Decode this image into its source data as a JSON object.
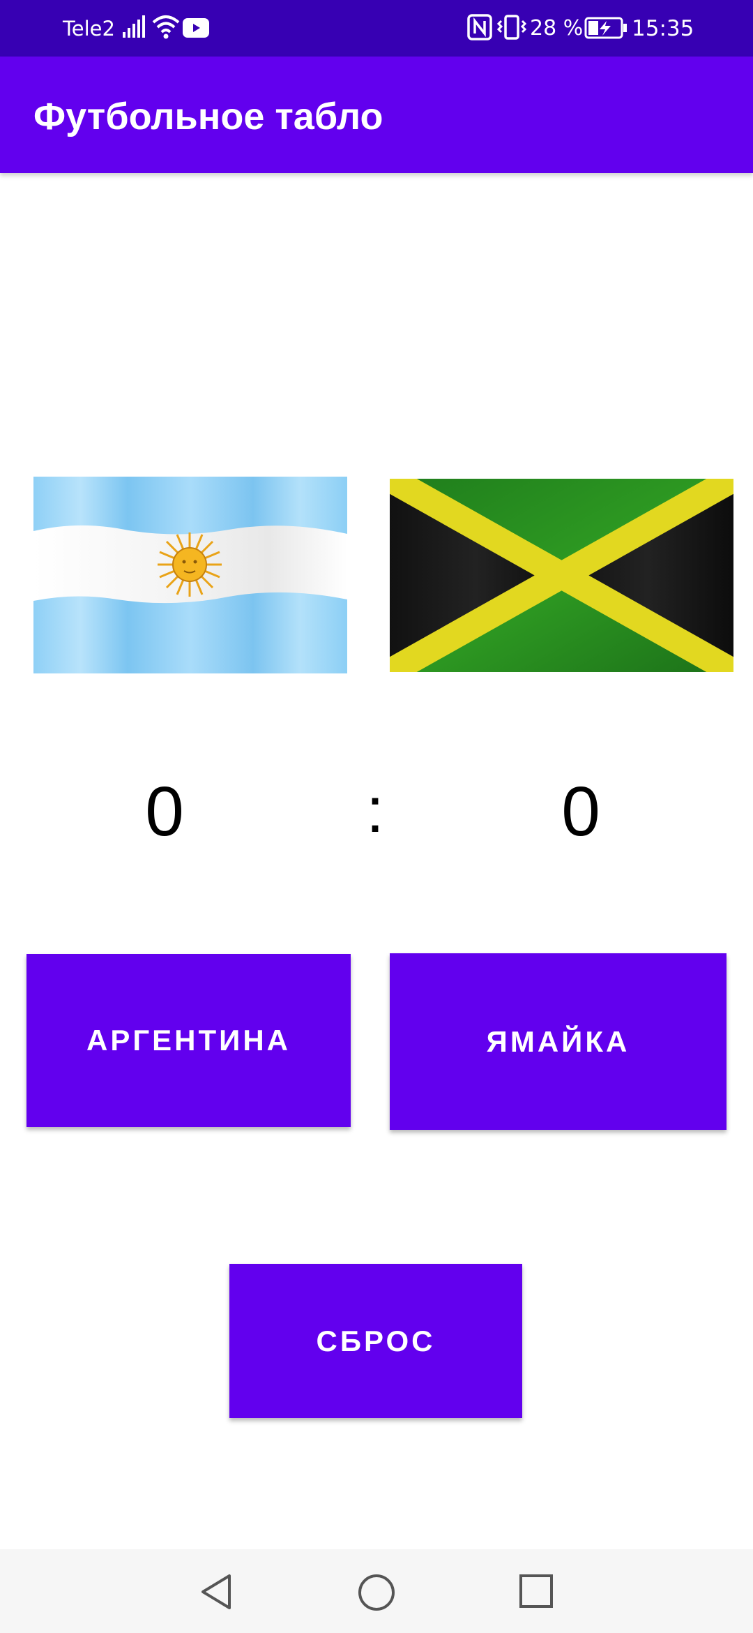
{
  "status_bar": {
    "carrier": "Tele2",
    "battery_percent": "28 %",
    "time": "15:35",
    "icons": [
      "signal-icon",
      "wifi-icon",
      "youtube-icon",
      "nfc-icon",
      "vibrate-icon",
      "battery-charging-icon"
    ]
  },
  "app_bar": {
    "title": "Футбольное табло"
  },
  "teams": [
    {
      "flag": "argentina-flag"
    },
    {
      "flag": "jamaica-flag"
    }
  ],
  "scoreboard": {
    "left_score": "0",
    "separator": ":",
    "right_score": "0"
  },
  "buttons": {
    "team1_label": "АРГЕНТИНА",
    "team2_label": "ЯМАЙКА",
    "reset_label": "СБРОС"
  },
  "nav_bar": {
    "icons": [
      "back-icon",
      "home-icon",
      "recents-icon"
    ]
  },
  "colors": {
    "status_bar": "#3700b3",
    "primary": "#6200ee",
    "button_text": "#ffffff",
    "score_text": "#000000"
  }
}
